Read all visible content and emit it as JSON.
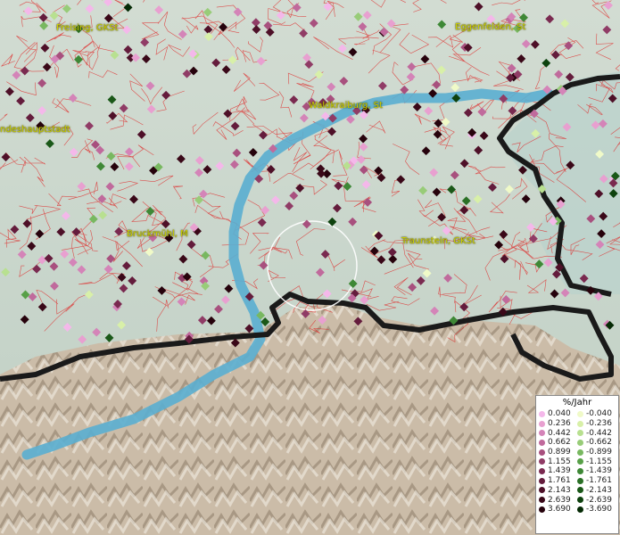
{
  "map": {
    "cities": [
      {
        "id": "freising",
        "label": "Freising, GKSt"
      },
      {
        "id": "eggenfelden",
        "label": "Eggenfelden, St"
      },
      {
        "id": "landeshauptstadt",
        "label": "ndeshauptstadt"
      },
      {
        "id": "waldkraiburg",
        "label": "Waldkraiburg, St"
      },
      {
        "id": "bruckmuehl",
        "label": "Bruckmühl, M"
      },
      {
        "id": "traunstein",
        "label": "Traunstein, GKSt"
      }
    ],
    "colors": {
      "water": "#5aaed0",
      "border": "#1a1a1a",
      "municipal_lines": "#e02020",
      "lowland": "#c8d6c8",
      "alps": "#c9bba8"
    }
  },
  "legend": {
    "title": "%/Jahr",
    "positive": [
      {
        "label": "0.040",
        "color": "#f4b8ea"
      },
      {
        "label": "0.236",
        "color": "#e8a0d0"
      },
      {
        "label": "0.442",
        "color": "#d484b8"
      },
      {
        "label": "0.662",
        "color": "#c06a9c"
      },
      {
        "label": "0.899",
        "color": "#a8507e"
      },
      {
        "label": "1.155",
        "color": "#903c66"
      },
      {
        "label": "1.439",
        "color": "#7a2a50"
      },
      {
        "label": "1.761",
        "color": "#641c3c"
      },
      {
        "label": "2.143",
        "color": "#4e1028"
      },
      {
        "label": "2.639",
        "color": "#3a0818"
      },
      {
        "label": "3.690",
        "color": "#26020c"
      }
    ],
    "negative": [
      {
        "label": "-0.040",
        "color": "#f0fac8"
      },
      {
        "label": "-0.236",
        "color": "#d8f0a8"
      },
      {
        "label": "-0.442",
        "color": "#b8e090"
      },
      {
        "label": "-0.662",
        "color": "#98cc78"
      },
      {
        "label": "-0.899",
        "color": "#78b860"
      },
      {
        "label": "-1.155",
        "color": "#58a048"
      },
      {
        "label": "-1.439",
        "color": "#3e8836"
      },
      {
        "label": "-1.761",
        "color": "#2a7026"
      },
      {
        "label": "-2.143",
        "color": "#1a5818"
      },
      {
        "label": "-2.639",
        "color": "#0e420e"
      },
      {
        "label": "-3.690",
        "color": "#052a05"
      }
    ]
  }
}
